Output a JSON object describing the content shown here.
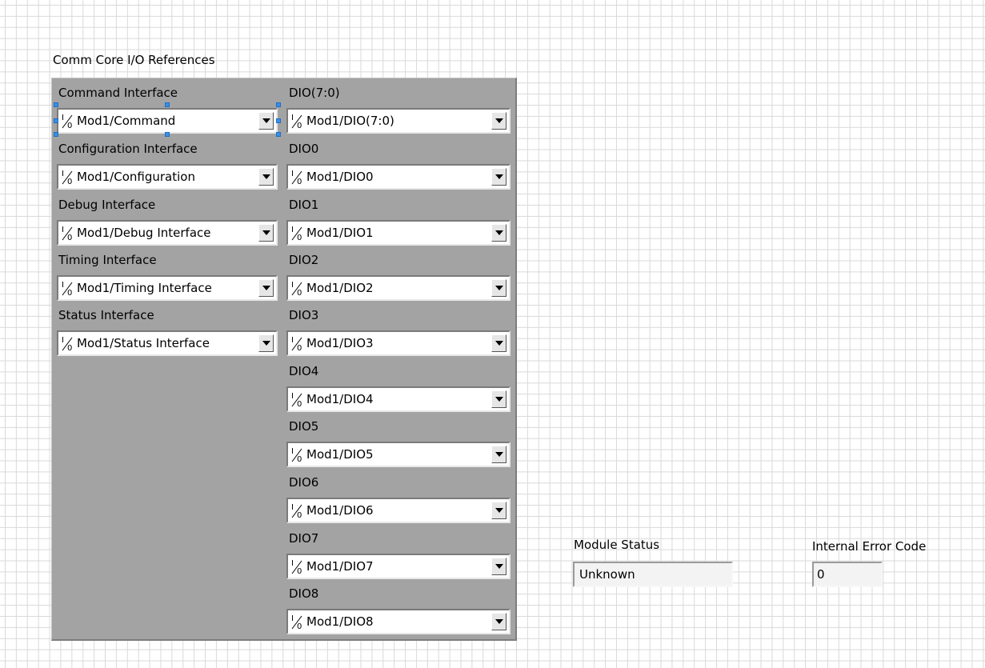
{
  "cluster": {
    "title": "Comm Core I/O References",
    "left_column": [
      {
        "label": "Command Interface",
        "value": "Mod1/Command"
      },
      {
        "label": "Configuration Interface",
        "value": "Mod1/Configuration"
      },
      {
        "label": "Debug Interface",
        "value": "Mod1/Debug Interface"
      },
      {
        "label": "Timing Interface",
        "value": "Mod1/Timing Interface"
      },
      {
        "label": "Status Interface",
        "value": "Mod1/Status Interface"
      }
    ],
    "right_column": [
      {
        "label": "DIO(7:0)",
        "value": "Mod1/DIO(7:0)"
      },
      {
        "label": "DIO0",
        "value": "Mod1/DIO0"
      },
      {
        "label": "DIO1",
        "value": "Mod1/DIO1"
      },
      {
        "label": "DIO2",
        "value": "Mod1/DIO2"
      },
      {
        "label": "DIO3",
        "value": "Mod1/DIO3"
      },
      {
        "label": "DIO4",
        "value": "Mod1/DIO4"
      },
      {
        "label": "DIO5",
        "value": "Mod1/DIO5"
      },
      {
        "label": "DIO6",
        "value": "Mod1/DIO6"
      },
      {
        "label": "DIO7",
        "value": "Mod1/DIO7"
      },
      {
        "label": "DIO8",
        "value": "Mod1/DIO8"
      }
    ]
  },
  "module_status": {
    "label": "Module Status",
    "value": "Unknown"
  },
  "internal_error": {
    "label": "Internal Error Code",
    "value": "0"
  },
  "colors": {
    "panel": "#a3a3a3",
    "grid": "#d9d9d9",
    "selection": "#3b8ee6"
  },
  "icons": {
    "io_reference": "io-reference-icon",
    "dropdown": "dropdown-arrow-icon"
  }
}
